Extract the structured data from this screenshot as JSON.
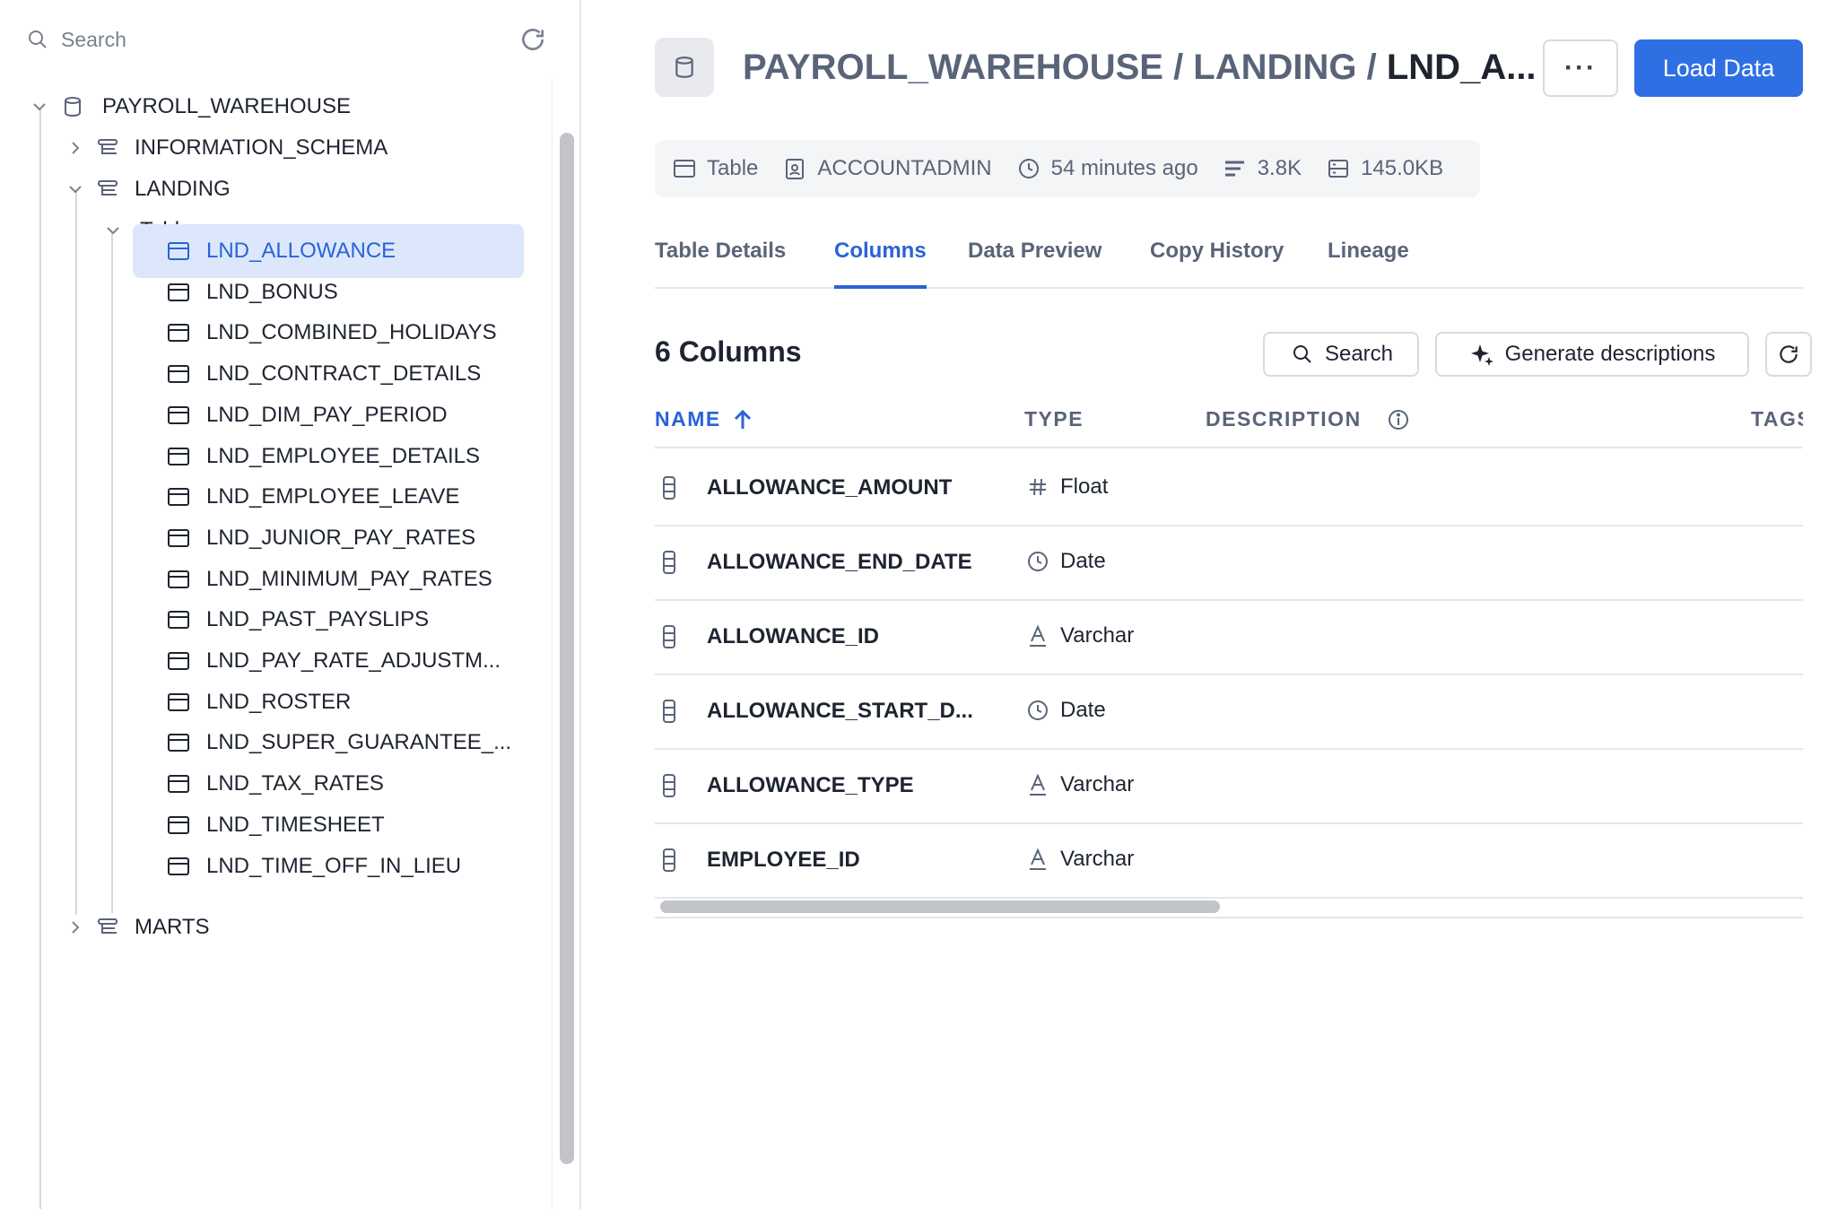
{
  "sidebar": {
    "search_label": "Search",
    "tree": {
      "database": "PAYROLL_WAREHOUSE",
      "schemas": [
        {
          "name": "INFORMATION_SCHEMA",
          "expanded": false
        },
        {
          "name": "LANDING",
          "expanded": true
        },
        {
          "name": "MARTS",
          "expanded": false
        }
      ],
      "tables_group": "Tables",
      "tables": [
        "LND_ALLOWANCE",
        "LND_BONUS",
        "LND_COMBINED_HOLIDAYS",
        "LND_CONTRACT_DETAILS",
        "LND_DIM_PAY_PERIOD",
        "LND_EMPLOYEE_DETAILS",
        "LND_EMPLOYEE_LEAVE",
        "LND_JUNIOR_PAY_RATES",
        "LND_MINIMUM_PAY_RATES",
        "LND_PAST_PAYSLIPS",
        "LND_PAY_RATE_ADJUSTM...",
        "LND_ROSTER",
        "LND_SUPER_GUARANTEE_...",
        "LND_TAX_RATES",
        "LND_TIMESHEET",
        "LND_TIME_OFF_IN_LIEU"
      ],
      "selected_table": "LND_ALLOWANCE"
    }
  },
  "header": {
    "path_prefix": "PAYROLL_WAREHOUSE / LANDING / ",
    "path_last": "LND_A...",
    "more_label": "···",
    "load_button": "Load Data"
  },
  "meta": {
    "kind": "Table",
    "owner": "ACCOUNTADMIN",
    "updated": "54 minutes ago",
    "rows": "3.8K",
    "size": "145.0KB"
  },
  "tabs": [
    "Table Details",
    "Columns",
    "Data Preview",
    "Copy History",
    "Lineage"
  ],
  "active_tab": "Columns",
  "columns_panel": {
    "count_label": "6 Columns",
    "search_button": "Search",
    "generate_button": "Generate descriptions",
    "headers": {
      "name": "NAME",
      "type": "TYPE",
      "description": "DESCRIPTION",
      "tags": "TAGS"
    },
    "rows": [
      {
        "name": "ALLOWANCE_AMOUNT",
        "type": "Float",
        "type_icon": "hash-icon"
      },
      {
        "name": "ALLOWANCE_END_DATE",
        "type": "Date",
        "type_icon": "clock-icon"
      },
      {
        "name": "ALLOWANCE_ID",
        "type": "Varchar",
        "type_icon": "text-a-icon"
      },
      {
        "name": "ALLOWANCE_START_D...",
        "type": "Date",
        "type_icon": "clock-icon"
      },
      {
        "name": "ALLOWANCE_TYPE",
        "type": "Varchar",
        "type_icon": "text-a-icon"
      },
      {
        "name": "EMPLOYEE_ID",
        "type": "Varchar",
        "type_icon": "text-a-icon"
      }
    ]
  },
  "colors": {
    "accent": "#2f6fe4",
    "selected_bg": "#dde7fb",
    "text_primary": "#1e2430",
    "text_secondary": "#5a6479",
    "border": "#e3e6ec"
  }
}
